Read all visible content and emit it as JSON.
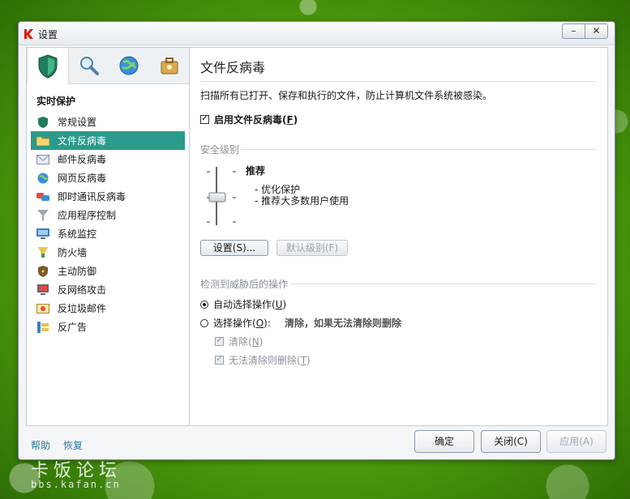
{
  "window": {
    "title": "设置",
    "minimize": "–",
    "close": "✕"
  },
  "left": {
    "group_title": "实时保护",
    "items": [
      {
        "label": "常规设置",
        "icon": "shield-icon"
      },
      {
        "label": "文件反病毒",
        "icon": "folder-icon",
        "active": true
      },
      {
        "label": "邮件反病毒",
        "icon": "mail-icon"
      },
      {
        "label": "网页反病毒",
        "icon": "globe-icon"
      },
      {
        "label": "即时通讯反病毒",
        "icon": "chat-icon"
      },
      {
        "label": "应用程序控制",
        "icon": "filter-icon"
      },
      {
        "label": "系统监控",
        "icon": "monitor-icon"
      },
      {
        "label": "防火墙",
        "icon": "firewall-icon"
      },
      {
        "label": "主动防御",
        "icon": "defense-icon"
      },
      {
        "label": "反网络攻击",
        "icon": "network-attack-icon"
      },
      {
        "label": "反垃圾邮件",
        "icon": "antispam-icon"
      },
      {
        "label": "反广告",
        "icon": "antibanner-icon"
      }
    ]
  },
  "main": {
    "title": "文件反病毒",
    "description": "扫描所有已打开、保存和执行的文件，防止计算机文件系统被感染。",
    "enable_label": "启用文件反病毒(",
    "enable_key": "F",
    "enable_suffix": ")",
    "security_level_title": "安全级别",
    "level_name": "推荐",
    "level_desc_1": "- 优化保护",
    "level_desc_2": "- 推荐大多数用户使用",
    "settings_btn": "设置(S)...",
    "default_btn": "默认级别(F)",
    "action_title": "检测到威胁后的操作",
    "auto_action": "自动选择操作(",
    "auto_key": "U",
    "select_action": "选择操作(",
    "select_key": "O",
    "select_suffix": "):",
    "select_value": "清除，如果无法清除则删除",
    "clean_label": "清除(",
    "clean_key": "N",
    "delete_label": "无法清除则删除(",
    "delete_key": "T",
    "close_paren": ")"
  },
  "footer": {
    "help": "帮助",
    "restore": "恢复",
    "ok": "确定",
    "close": "关闭(C)",
    "apply": "应用(A)"
  },
  "watermark": {
    "line1": "卡饭论坛",
    "line2": "bbs.kafan.cn"
  }
}
